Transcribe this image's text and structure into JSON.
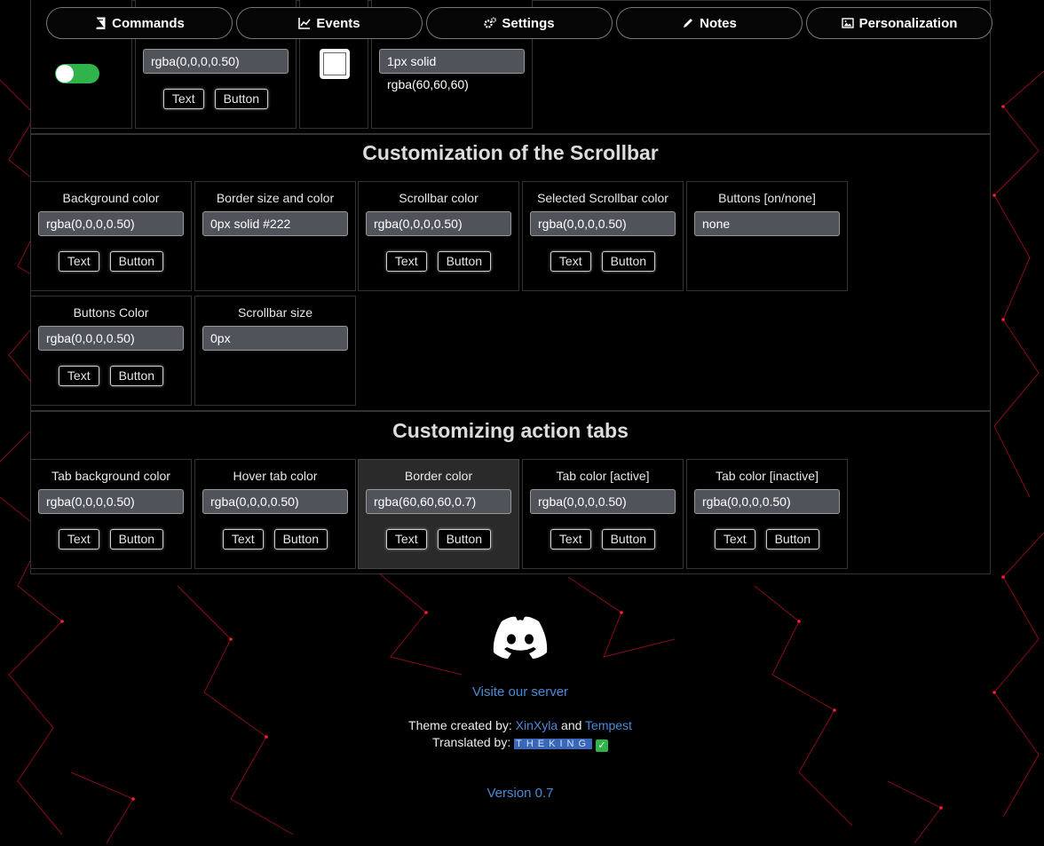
{
  "nav": {
    "tabs": [
      {
        "label": "Commands",
        "icon": "book-icon"
      },
      {
        "label": "Events",
        "icon": "line-chart-icon"
      },
      {
        "label": "Settings",
        "icon": "gears-icon"
      },
      {
        "label": "Notes",
        "icon": "pencil-icon"
      },
      {
        "label": "Personalization",
        "icon": "image-icon"
      }
    ]
  },
  "top_row": {
    "color_value": "rgba(0,0,0,0.50)",
    "border_value": "1px solid rgba(60,60,60)",
    "text_label": "Text",
    "button_label": "Button"
  },
  "scrollbar_section": {
    "title": "Customization of the Scrollbar",
    "cells": [
      {
        "label": "Background color",
        "value": "rgba(0,0,0,0.50)",
        "buttons": true
      },
      {
        "label": "Border size and color",
        "value": "0px solid #222",
        "buttons": false
      },
      {
        "label": "Scrollbar color",
        "value": "rgba(0,0,0,0.50)",
        "buttons": true
      },
      {
        "label": "Selected Scrollbar color",
        "value": "rgba(0,0,0,0.50)",
        "buttons": true
      },
      {
        "label": "Buttons [on/none]",
        "value": "none",
        "buttons": false
      },
      {
        "label": "Buttons Color",
        "value": "rgba(0,0,0,0.50)",
        "buttons": true
      },
      {
        "label": "Scrollbar size",
        "value": "0px",
        "buttons": false
      }
    ]
  },
  "tabs_section": {
    "title": "Customizing action tabs",
    "cells": [
      {
        "label": "Tab background color",
        "value": "rgba(0,0,0,0.50)",
        "buttons": true
      },
      {
        "label": "Hover tab color",
        "value": "rgba(0,0,0,0.50)",
        "buttons": true
      },
      {
        "label": "Border color",
        "value": "rgba(60,60,60,0.7)",
        "buttons": true
      },
      {
        "label": "Tab color [active]",
        "value": "rgba(0,0,0,0.50)",
        "buttons": true
      },
      {
        "label": "Tab color [inactive]",
        "value": "rgba(0,0,0,0.50)",
        "buttons": true
      }
    ]
  },
  "buttons": {
    "text": "Text",
    "button": "Button"
  },
  "footer": {
    "visit_link": "Visite our server",
    "created_prefix": "Theme created by:",
    "author1": "XinXyla",
    "and": "and",
    "author2": "Tempest",
    "translated_prefix": "Translated by:",
    "translator": "THEKING",
    "version": "Version 0.7"
  },
  "colors": {
    "background": "#000000",
    "accent_red": "#c0101a",
    "link": "#4a8ad6",
    "input_bg": "#50545a",
    "toggle_on": "#2fb34a"
  }
}
